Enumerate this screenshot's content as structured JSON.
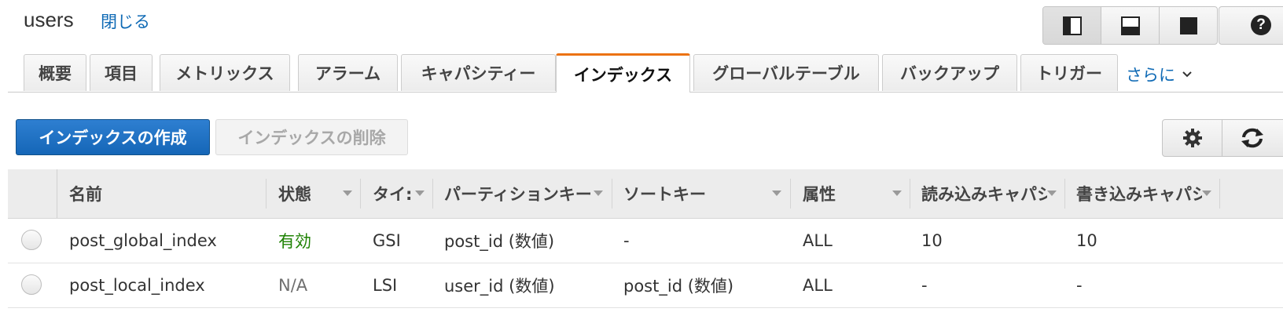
{
  "header": {
    "title": "users",
    "close_label": "閉じる"
  },
  "tabs": [
    {
      "label": "概要"
    },
    {
      "label": "項目"
    },
    {
      "label": "メトリックス"
    },
    {
      "label": "アラーム"
    },
    {
      "label": "キャパシティー"
    },
    {
      "label": "インデックス"
    },
    {
      "label": "グローバルテーブル"
    },
    {
      "label": "バックアップ"
    },
    {
      "label": "トリガー"
    }
  ],
  "active_tab": "インデックス",
  "more_label": "さらに",
  "toolbar": {
    "create_label": "インデックスの作成",
    "delete_label": "インデックスの削除"
  },
  "table": {
    "columns": [
      "名前",
      "状態",
      "タイ:",
      "パーティションキー",
      "ソートキー",
      "属性",
      "読み込みキャパシ",
      "書き込みキャパシ"
    ],
    "rows": [
      {
        "name": "post_global_index",
        "status": "有効",
        "type": "GSI",
        "partition_key": "post_id (数値)",
        "sort_key": "-",
        "attributes": "ALL",
        "read_capacity": "10",
        "write_capacity": "10"
      },
      {
        "name": "post_local_index",
        "status": "N/A",
        "type": "LSI",
        "partition_key": "user_id (数値)",
        "sort_key": "post_id (数値)",
        "attributes": "ALL",
        "read_capacity": "-",
        "write_capacity": "-"
      }
    ]
  },
  "colors": {
    "accent_tab": "#ec7211",
    "primary_button": "#1566b7",
    "link": "#0f6ab5",
    "status_active": "#1d8102"
  },
  "icons": [
    "split-right-panel-icon",
    "split-bottom-panel-icon",
    "full-panel-icon",
    "help-icon",
    "gear-icon",
    "refresh-icon",
    "chevron-down-icon"
  ]
}
